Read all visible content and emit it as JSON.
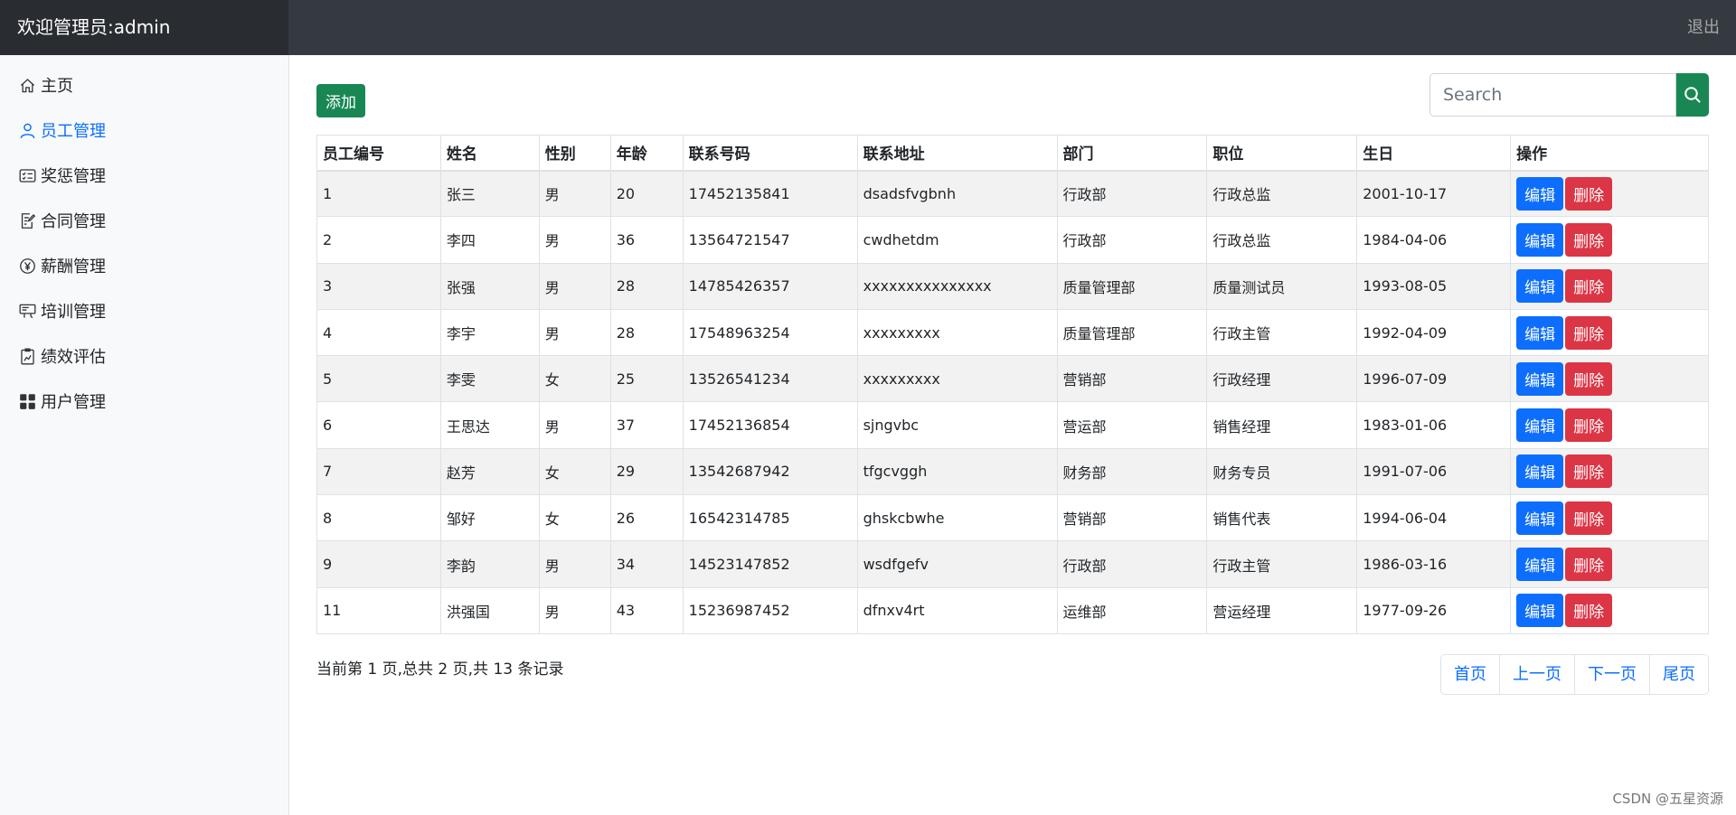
{
  "header": {
    "brand": "欢迎管理员:admin",
    "logout": "退出"
  },
  "sidebar": {
    "items": [
      {
        "label": "主页",
        "icon": "home-icon"
      },
      {
        "label": "员工管理",
        "icon": "person-icon",
        "active": true
      },
      {
        "label": "奖惩管理",
        "icon": "card-checklist-icon"
      },
      {
        "label": "合同管理",
        "icon": "document-edit-icon"
      },
      {
        "label": "薪酬管理",
        "icon": "yen-coin-icon"
      },
      {
        "label": "培训管理",
        "icon": "presentation-icon"
      },
      {
        "label": "绩效评估",
        "icon": "clipboard-chart-icon"
      },
      {
        "label": "用户管理",
        "icon": "grid-icon"
      }
    ]
  },
  "toolbar": {
    "add_label": "添加",
    "search_placeholder": "Search",
    "search_icon": "search-icon"
  },
  "table": {
    "headers": [
      "员工编号",
      "姓名",
      "性别",
      "年龄",
      "联系号码",
      "联系地址",
      "部门",
      "职位",
      "生日",
      "操作"
    ],
    "rows": [
      [
        "1",
        "张三",
        "男",
        "20",
        "17452135841",
        "dsadsfvgbnh",
        "行政部",
        "行政总监",
        "2001-10-17"
      ],
      [
        "2",
        "李四",
        "男",
        "36",
        "13564721547",
        "cwdhetdm",
        "行政部",
        "行政总监",
        "1984-04-06"
      ],
      [
        "3",
        "张强",
        "男",
        "28",
        "14785426357",
        "xxxxxxxxxxxxxxx",
        "质量管理部",
        "质量测试员",
        "1993-08-05"
      ],
      [
        "4",
        "李宇",
        "男",
        "28",
        "17548963254",
        "xxxxxxxxx",
        "质量管理部",
        "行政主管",
        "1992-04-09"
      ],
      [
        "5",
        "李雯",
        "女",
        "25",
        "13526541234",
        "xxxxxxxxx",
        "营销部",
        "行政经理",
        "1996-07-09"
      ],
      [
        "6",
        "王思达",
        "男",
        "37",
        "17452136854",
        "sjngvbc",
        "营运部",
        "销售经理",
        "1983-01-06"
      ],
      [
        "7",
        "赵芳",
        "女",
        "29",
        "13542687942",
        "tfgcvggh",
        "财务部",
        "财务专员",
        "1991-07-06"
      ],
      [
        "8",
        "邹好",
        "女",
        "26",
        "16542314785",
        "ghskcbwhe",
        "营销部",
        "销售代表",
        "1994-06-04"
      ],
      [
        "9",
        "李韵",
        "男",
        "34",
        "14523147852",
        "wsdfgefv",
        "行政部",
        "行政主管",
        "1986-03-16"
      ],
      [
        "11",
        "洪强国",
        "男",
        "43",
        "15236987452",
        "dfnxv4rt",
        "运维部",
        "营运经理",
        "1977-09-26"
      ]
    ],
    "edit_label": "编辑",
    "delete_label": "删除"
  },
  "pagination": {
    "info": "当前第 1 页,总共 2 页,共 13 条记录",
    "first": "首页",
    "prev": "上一页",
    "next": "下一页",
    "last": "尾页"
  },
  "watermark": "CSDN @五星资源",
  "colors": {
    "topbar": "#343a40",
    "primary": "#0d6efd",
    "success": "#198754",
    "danger": "#dc3545"
  }
}
